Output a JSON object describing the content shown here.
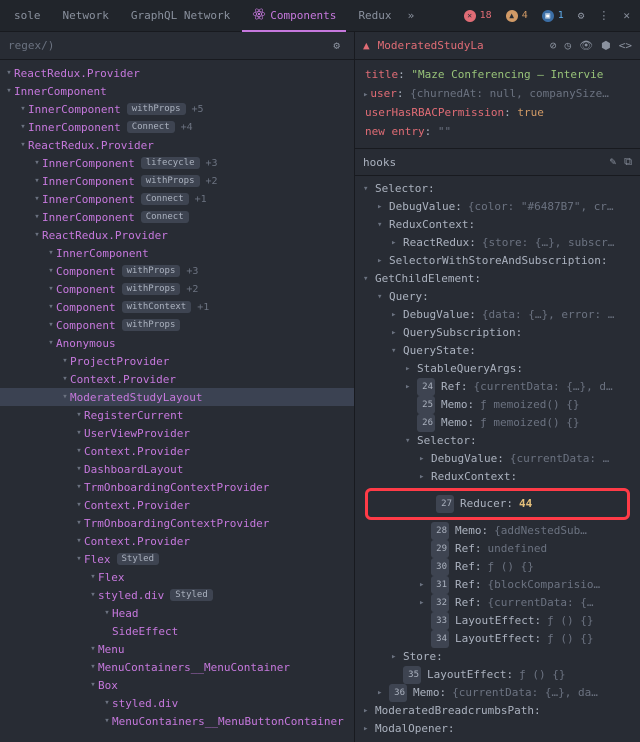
{
  "tabs": {
    "items": [
      "sole",
      "Network",
      "GraphQL Network",
      "Components",
      "Redux"
    ],
    "active_index": 3,
    "more": "»",
    "errors": "18",
    "warnings": "4",
    "info": "1"
  },
  "search": {
    "placeholder": "regex/)"
  },
  "tree": [
    {
      "d": 0,
      "a": "▾",
      "label": "ReactRedux.Provider"
    },
    {
      "d": 0,
      "a": "▾",
      "label": "InnerComponent"
    },
    {
      "d": 1,
      "a": "▾",
      "label": "InnerComponent",
      "tag": "withProps",
      "count": "+5"
    },
    {
      "d": 1,
      "a": "▾",
      "label": "InnerComponent",
      "tag": "Connect",
      "count": "+4"
    },
    {
      "d": 1,
      "a": "▾",
      "label": "ReactRedux.Provider"
    },
    {
      "d": 2,
      "a": "▾",
      "label": "InnerComponent",
      "tag": "lifecycle",
      "count": "+3"
    },
    {
      "d": 2,
      "a": "▾",
      "label": "InnerComponent",
      "tag": "withProps",
      "count": "+2"
    },
    {
      "d": 2,
      "a": "▾",
      "label": "InnerComponent",
      "tag": "Connect",
      "count": "+1"
    },
    {
      "d": 2,
      "a": "▾",
      "label": "InnerComponent",
      "tag": "Connect"
    },
    {
      "d": 2,
      "a": "▾",
      "label": "ReactRedux.Provider"
    },
    {
      "d": 3,
      "a": "▾",
      "label": "InnerComponent"
    },
    {
      "d": 3,
      "a": "▾",
      "label": "Component",
      "tag": "withProps",
      "count": "+3"
    },
    {
      "d": 3,
      "a": "▾",
      "label": "Component",
      "tag": "withProps",
      "count": "+2"
    },
    {
      "d": 3,
      "a": "▾",
      "label": "Component",
      "tag": "withContext",
      "count": "+1"
    },
    {
      "d": 3,
      "a": "▾",
      "label": "Component",
      "tag": "withProps"
    },
    {
      "d": 3,
      "a": "▾",
      "label": "Anonymous"
    },
    {
      "d": 4,
      "a": "▾",
      "label": "ProjectProvider"
    },
    {
      "d": 4,
      "a": "▾",
      "label": "Context.Provider"
    },
    {
      "d": 4,
      "a": "▾",
      "label": "ModeratedStudyLayout",
      "selected": true
    },
    {
      "d": 5,
      "a": "▾",
      "label": "RegisterCurrent"
    },
    {
      "d": 5,
      "a": "▾",
      "label": "UserViewProvider"
    },
    {
      "d": 5,
      "a": "▾",
      "label": "Context.Provider"
    },
    {
      "d": 5,
      "a": "▾",
      "label": "DashboardLayout"
    },
    {
      "d": 5,
      "a": "▾",
      "label": "TrmOnboardingContextProvider"
    },
    {
      "d": 5,
      "a": "▾",
      "label": "Context.Provider"
    },
    {
      "d": 5,
      "a": "▾",
      "label": "TrmOnboardingContextProvider"
    },
    {
      "d": 5,
      "a": "▾",
      "label": "Context.Provider"
    },
    {
      "d": 5,
      "a": "▾",
      "label": "Flex",
      "tag": "Styled"
    },
    {
      "d": 6,
      "a": "▾",
      "label": "Flex"
    },
    {
      "d": 6,
      "a": "▾",
      "label": "styled.div",
      "tag": "Styled"
    },
    {
      "d": 7,
      "a": "▾",
      "label": "Head"
    },
    {
      "d": 7,
      "a": "",
      "label": "SideEffect"
    },
    {
      "d": 6,
      "a": "▾",
      "label": "Menu"
    },
    {
      "d": 6,
      "a": "▾",
      "label": "MenuContainers__MenuContainer"
    },
    {
      "d": 6,
      "a": "▾",
      "label": "Box"
    },
    {
      "d": 7,
      "a": "▾",
      "label": "styled.div"
    },
    {
      "d": 7,
      "a": "▾",
      "label": "MenuContainers__MenuButtonContainer"
    }
  ],
  "details": {
    "title": "ModeratedStudyLa",
    "props": [
      {
        "k": "title",
        "v": "\"Maze Conferencing — Intervie",
        "t": "str",
        "arrow": ""
      },
      {
        "k": "user",
        "v": "{churnedAt: null, companySize…",
        "t": "obj",
        "arrow": "▸"
      },
      {
        "k": "userHasRBACPermission",
        "v": "true",
        "t": "kw",
        "arrow": ""
      },
      {
        "k": "new entry",
        "v": "\"\"",
        "t": "dim",
        "arrow": ""
      }
    ]
  },
  "hooks": {
    "title": "hooks",
    "rows": [
      {
        "d": 0,
        "a": "▾",
        "k": "Selector",
        "v": ""
      },
      {
        "d": 1,
        "a": "▸",
        "k": "DebugValue",
        "v": "{color: \"#6487B7\", cr…"
      },
      {
        "d": 1,
        "a": "▾",
        "k": "ReduxContext",
        "v": ""
      },
      {
        "d": 2,
        "a": "▸",
        "k": "ReactRedux",
        "v": "{store: {…}, subscr…"
      },
      {
        "d": 1,
        "a": "▸",
        "k": "SelectorWithStoreAndSubscription",
        "v": ""
      },
      {
        "d": 0,
        "a": "▾",
        "k": "GetChildElement",
        "v": ""
      },
      {
        "d": 1,
        "a": "▾",
        "k": "Query",
        "v": ""
      },
      {
        "d": 2,
        "a": "▸",
        "k": "DebugValue",
        "v": "{data: {…}, error: …"
      },
      {
        "d": 2,
        "a": "▸",
        "k": "QuerySubscription",
        "v": ""
      },
      {
        "d": 2,
        "a": "▾",
        "k": "QueryState",
        "v": ""
      },
      {
        "d": 3,
        "a": "▸",
        "k": "StableQueryArgs",
        "v": ""
      },
      {
        "d": 3,
        "a": "▸",
        "n": "24",
        "k": "Ref",
        "v": "{currentData: {…}, d…"
      },
      {
        "d": 3,
        "a": "",
        "n": "25",
        "k": "Memo",
        "v": "ƒ memoized() {}"
      },
      {
        "d": 3,
        "a": "",
        "n": "26",
        "k": "Memo",
        "v": "ƒ memoized() {}"
      },
      {
        "d": 3,
        "a": "▾",
        "k": "Selector",
        "v": ""
      },
      {
        "d": 4,
        "a": "▸",
        "k": "DebugValue",
        "v": "{currentData: …"
      },
      {
        "d": 4,
        "a": "▸",
        "k": "ReduxContext",
        "v": ""
      },
      {
        "d": 4,
        "a": "",
        "n": "27",
        "k": "Reducer",
        "v": "44",
        "highlight": true
      },
      {
        "d": 4,
        "a": "",
        "n": "28",
        "k": "Memo",
        "v": "{addNestedSub…"
      },
      {
        "d": 4,
        "a": "",
        "n": "29",
        "k": "Ref",
        "v": "undefined"
      },
      {
        "d": 4,
        "a": "",
        "n": "30",
        "k": "Ref",
        "v": "ƒ () {}"
      },
      {
        "d": 4,
        "a": "▸",
        "n": "31",
        "k": "Ref",
        "v": "{blockComparisio…"
      },
      {
        "d": 4,
        "a": "▸",
        "n": "32",
        "k": "Ref",
        "v": "{currentData: {…"
      },
      {
        "d": 4,
        "a": "",
        "n": "33",
        "k": "LayoutEffect",
        "v": "ƒ () {}"
      },
      {
        "d": 4,
        "a": "",
        "n": "34",
        "k": "LayoutEffect",
        "v": "ƒ () {}"
      },
      {
        "d": 2,
        "a": "▸",
        "k": "Store",
        "v": ""
      },
      {
        "d": 2,
        "a": "",
        "n": "35",
        "k": "LayoutEffect",
        "v": "ƒ () {}"
      },
      {
        "d": 1,
        "a": "▸",
        "n": "36",
        "k": "Memo",
        "v": "{currentData: {…}, da…"
      },
      {
        "d": 0,
        "a": "▸",
        "k": "ModeratedBreadcrumbsPath",
        "v": ""
      },
      {
        "d": 0,
        "a": "▸",
        "k": "ModalOpener",
        "v": ""
      }
    ]
  }
}
